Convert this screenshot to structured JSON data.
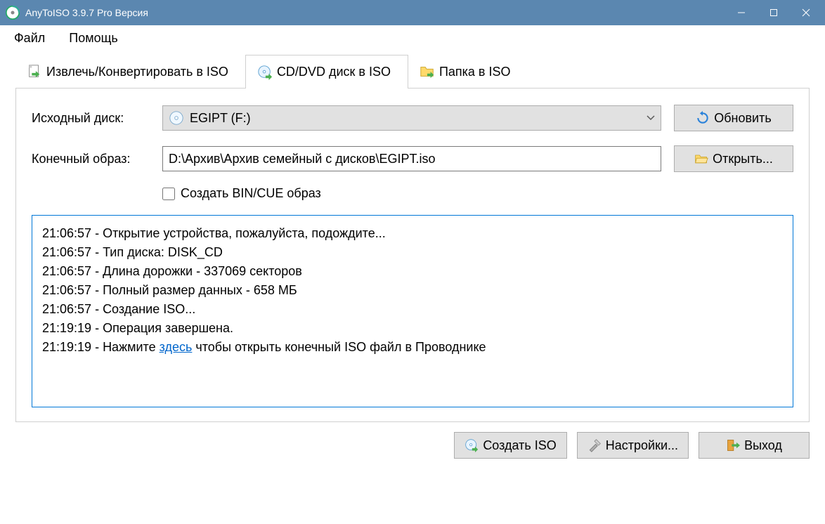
{
  "window": {
    "title": "AnyToISO 3.9.7 Pro Версия"
  },
  "menu": {
    "file": "Файл",
    "help": "Помощь"
  },
  "tabs": {
    "extract": "Извлечь/Конвертировать в ISO",
    "cd": "CD/DVD диск в ISO",
    "folder": "Папка в ISO"
  },
  "form": {
    "source_label": "Исходный диск:",
    "source_value": "EGIPT (F:)",
    "refresh": "Обновить",
    "dest_label": "Конечный образ:",
    "dest_value": "D:\\Архив\\Архив семейный с дисков\\EGIPT.iso",
    "open": "Открыть...",
    "bincue": "Создать BIN/CUE образ"
  },
  "log": {
    "l0": "21:06:57 - Открытие устройства, пожалуйста, подождите...",
    "l1": "21:06:57 - Тип диска: DISK_CD",
    "l2": "21:06:57 - Длина дорожки - 337069 секторов",
    "l3": "21:06:57 - Полный размер данных - 658 МБ",
    "l4": "21:06:57 - Создание ISO...",
    "l5": "21:19:19 - Операция завершена.",
    "l6_pre": "21:19:19 - Нажмите ",
    "l6_link": "здесь",
    "l6_post": " чтобы открыть конечный ISO файл в Проводнике"
  },
  "footer": {
    "create": "Создать ISO",
    "settings": "Настройки...",
    "exit": "Выход"
  }
}
